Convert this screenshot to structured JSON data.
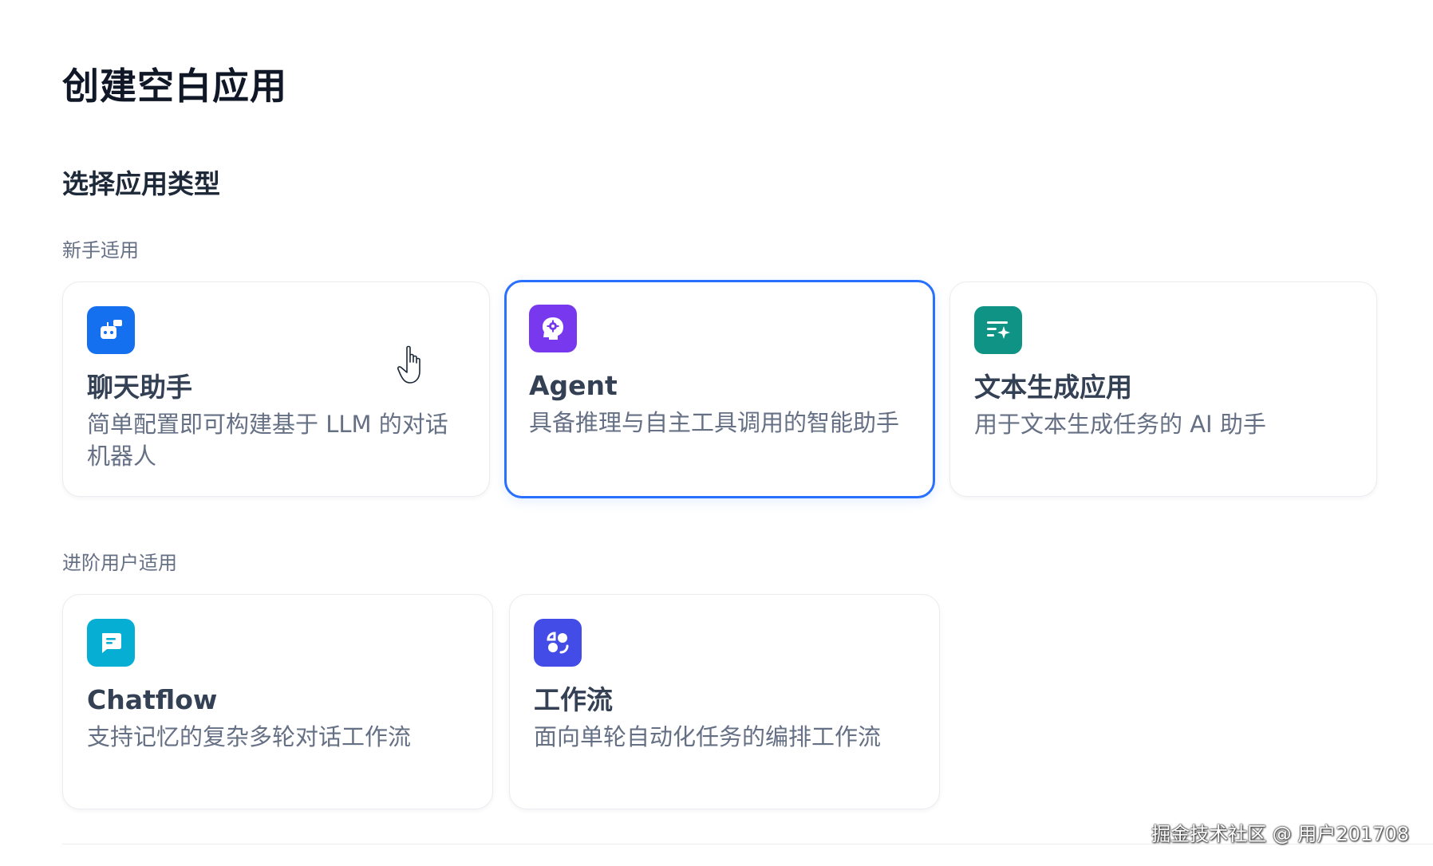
{
  "page": {
    "title": "创建空白应用",
    "section_title": "选择应用类型"
  },
  "groups": {
    "beginner": {
      "label": "新手适用",
      "cards": [
        {
          "title": "聊天助手",
          "description": "简单配置即可构建基于 LLM 的对话机器人",
          "icon": "chatbot-icon",
          "icon_color": "#1570ef"
        },
        {
          "title": "Agent",
          "description": "具备推理与自主工具调用的智能助手",
          "icon": "agent-head-gear-icon",
          "icon_color": "#7839ee",
          "selected": true
        },
        {
          "title": "文本生成应用",
          "description": "用于文本生成任务的 AI 助手",
          "icon": "text-generation-icon",
          "icon_color": "#0e9384"
        }
      ]
    },
    "advanced": {
      "label": "进阶用户适用",
      "cards": [
        {
          "title": "Chatflow",
          "description": "支持记忆的复杂多轮对话工作流",
          "icon": "chatflow-bubble-icon",
          "icon_color": "#06aed4"
        },
        {
          "title": "工作流",
          "description": "面向单轮自动化任务的编排工作流",
          "icon": "workflow-icon",
          "icon_color": "#444ce7"
        }
      ]
    }
  },
  "colors": {
    "selected_border": "#2970ff"
  },
  "watermark": "掘金技术社区 @ 用户201708"
}
